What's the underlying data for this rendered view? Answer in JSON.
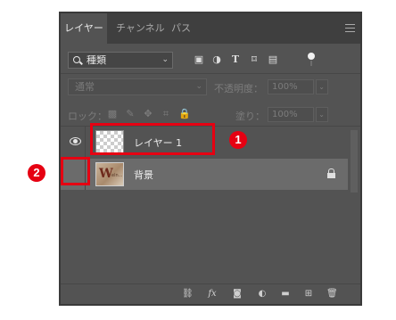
{
  "tabs": [
    {
      "label": "レイヤー",
      "active": true
    },
    {
      "label": "チャンネル",
      "active": false
    },
    {
      "label": "パス",
      "active": false
    }
  ],
  "panel_menu_icon": "hamburger-icon",
  "filter": {
    "kind_label": "種類",
    "icons": [
      "pixel-filter-icon",
      "adjustment-filter-icon",
      "type-filter-icon",
      "shape-filter-icon",
      "smart-object-filter-icon"
    ]
  },
  "blend_mode": "通常",
  "opacity": {
    "label": "不透明度：",
    "value": "100%"
  },
  "lock": {
    "label": "ロック：",
    "icons": [
      "lock-transparent-icon",
      "lock-brush-icon",
      "lock-move-icon",
      "lock-artboard-icon",
      "lock-all-icon"
    ]
  },
  "fill": {
    "label": "塗り：",
    "value": "100%"
  },
  "layers": [
    {
      "name": "レイヤー 1",
      "visible": true,
      "selected": false,
      "locked": false
    },
    {
      "name": "背景",
      "visible": false,
      "selected": true,
      "locked": true,
      "thumb_text": "W",
      "thumb_subtext": "eln..."
    }
  ],
  "bottom_icons": [
    "link-icon",
    "fx-icon",
    "mask-icon",
    "adjustment-icon",
    "folder-icon",
    "new-layer-icon",
    "trash-icon"
  ],
  "annotations": [
    {
      "label": "1",
      "color": "#e60012"
    },
    {
      "label": "2",
      "color": "#e60012"
    }
  ],
  "colors": {
    "panel": "#535353",
    "tabbar": "#3f3f3f",
    "selected_row": "#6b6b6b",
    "annotation": "#e60012"
  }
}
